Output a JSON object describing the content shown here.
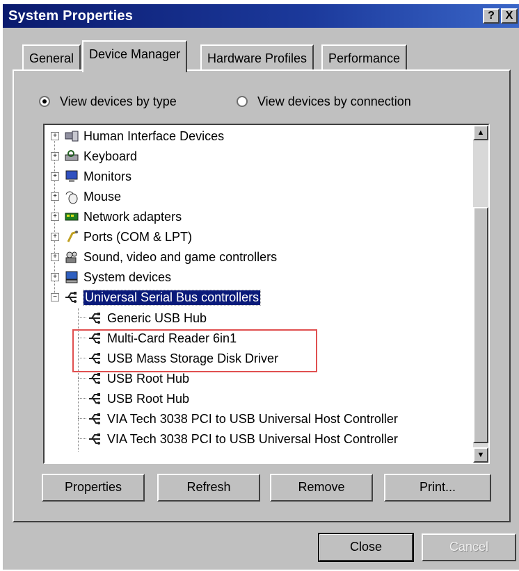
{
  "window": {
    "title": "System Properties",
    "help_label": "?",
    "close_label": "X"
  },
  "tabs": [
    {
      "label": "General"
    },
    {
      "label": "Device Manager"
    },
    {
      "label": "Hardware Profiles"
    },
    {
      "label": "Performance"
    }
  ],
  "view_options": {
    "by_type": "View devices by type",
    "by_connection": "View devices by connection",
    "selected": "by_type"
  },
  "tree": {
    "categories": [
      {
        "label": "Human Interface Devices",
        "icon": "hid-icon"
      },
      {
        "label": "Keyboard",
        "icon": "keyboard-icon"
      },
      {
        "label": "Monitors",
        "icon": "monitor-icon"
      },
      {
        "label": "Mouse",
        "icon": "mouse-icon"
      },
      {
        "label": "Network adapters",
        "icon": "network-adapter-icon"
      },
      {
        "label": "Ports (COM & LPT)",
        "icon": "port-icon"
      },
      {
        "label": "Sound, video and game controllers",
        "icon": "sound-icon"
      },
      {
        "label": "System devices",
        "icon": "system-devices-icon"
      },
      {
        "label": "Universal Serial Bus controllers",
        "icon": "usb-icon",
        "expanded": true,
        "selected": true
      }
    ],
    "usb_children": [
      {
        "label": "Generic USB Hub"
      },
      {
        "label": "Multi-Card Reader 6in1"
      },
      {
        "label": "USB Mass Storage Disk Driver"
      },
      {
        "label": "USB Root Hub"
      },
      {
        "label": "USB Root Hub"
      },
      {
        "label": "VIA Tech 3038 PCI to USB Universal Host Controller"
      },
      {
        "label": "VIA Tech 3038 PCI to USB Universal Host Controller"
      }
    ]
  },
  "action_buttons": {
    "properties": "Properties",
    "refresh": "Refresh",
    "remove": "Remove",
    "print": "Print..."
  },
  "dialog_buttons": {
    "close": "Close",
    "cancel": "Cancel"
  },
  "colors": {
    "titlebar": "#0a1a6e",
    "selection": "#0a1a7a",
    "highlight_box": "#e05050",
    "face": "#c0c0c0"
  }
}
